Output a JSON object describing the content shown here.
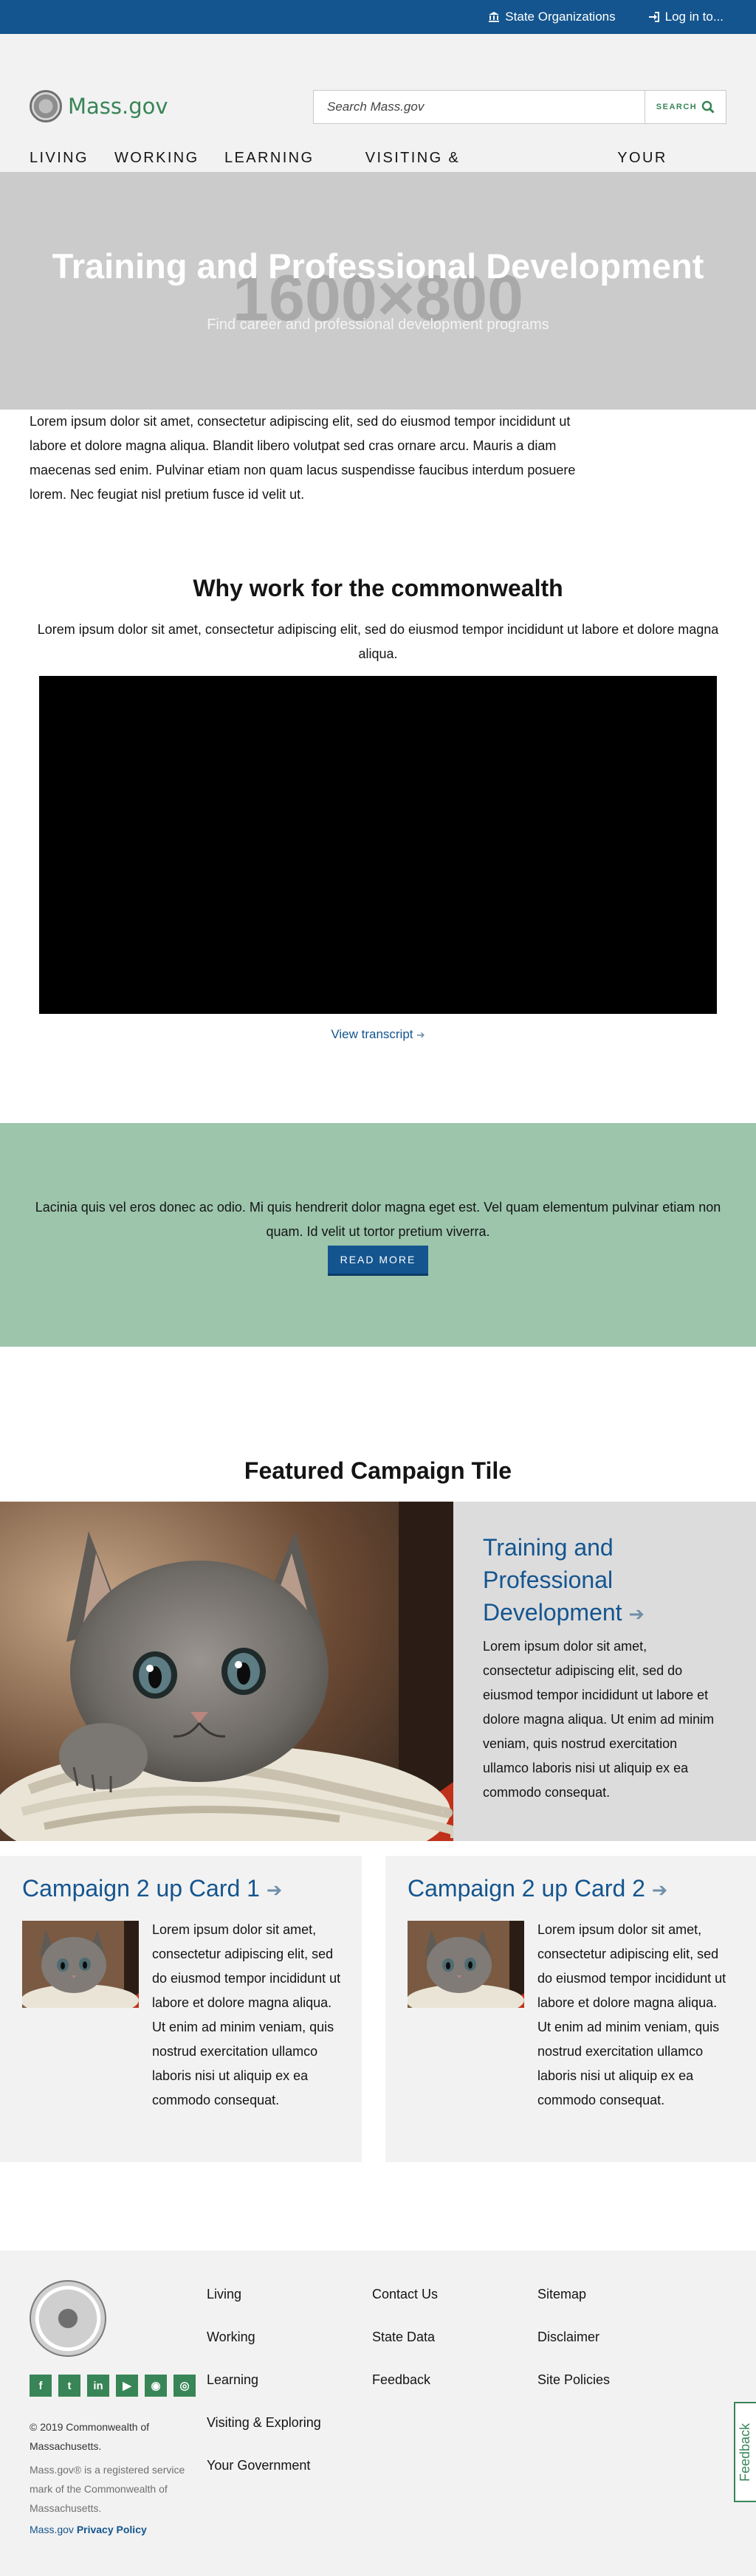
{
  "utility": {
    "state_orgs": "State Organizations",
    "login": "Log in to..."
  },
  "header": {
    "logo_text": "Mass.gov",
    "search_placeholder": "Search Mass.gov",
    "search_button": "SEARCH"
  },
  "nav": {
    "items": [
      {
        "label": "LIVING"
      },
      {
        "label": "WORKING"
      },
      {
        "label": "LEARNING"
      },
      {
        "label": "VISITING & EXPLORING"
      },
      {
        "label": "YOUR GOVERNMENT"
      }
    ]
  },
  "hero": {
    "placeholder": "1600×800",
    "title": "Training and Professional Development",
    "subtitle": "Find career and professional development programs"
  },
  "intro": {
    "text": "Lorem ipsum dolor sit amet, consectetur adipiscing elit, sed do eiusmod tempor incididunt ut labore et dolore magna aliqua. Blandit libero volutpat sed cras ornare arcu. Mauris a diam maecenas sed enim. Pulvinar etiam non quam lacus suspendisse faucibus interdum posuere lorem. Nec feugiat nisl pretium fusce id velit ut."
  },
  "why": {
    "title": "Why work for the commonwealth",
    "text": "Lorem ipsum dolor sit amet, consectetur adipiscing elit, sed do eiusmod tempor incididunt ut labore et dolore magna aliqua.",
    "transcript": "View transcript"
  },
  "band": {
    "text": "Lacinia quis vel eros donec ac odio. Mi quis hendrerit dolor magna eget est. Vel quam elementum pulvinar etiam non quam. Id velit ut tortor pretium viverra.",
    "button": "READ MORE"
  },
  "featured": {
    "heading": "Featured Campaign Tile",
    "title": "Training and Professional Development",
    "text": "Lorem ipsum dolor sit amet, consectetur adipiscing elit, sed do eiusmod tempor incididunt ut labore et dolore magna aliqua. Ut enim ad minim veniam, quis nostrud exercitation ullamco laboris nisi ut aliquip ex ea commodo consequat."
  },
  "cards": [
    {
      "title": "Campaign 2 up Card 1",
      "text": "Lorem ipsum dolor sit amet, consectetur adipiscing elit, sed do eiusmod tempor incididunt ut labore et dolore magna aliqua. Ut enim ad minim veniam, quis nostrud exercitation ullamco laboris nisi ut aliquip ex ea commodo consequat."
    },
    {
      "title": "Campaign 2 up Card 2",
      "text": "Lorem ipsum dolor sit amet, consectetur adipiscing elit, sed do eiusmod tempor incididunt ut labore et dolore magna aliqua. Ut enim ad minim veniam, quis nostrud exercitation ullamco laboris nisi ut aliquip ex ea commodo consequat."
    }
  ],
  "footer": {
    "col1": [
      "Living",
      "Working",
      "Learning",
      "Visiting & Exploring",
      "Your Government"
    ],
    "col2": [
      "Contact Us",
      "State Data",
      "Feedback"
    ],
    "col3": [
      "Sitemap",
      "Disclaimer",
      "Site Policies"
    ],
    "copyright": "© 2019 Commonwealth of Massachusetts.",
    "trademark": "Mass.gov® is a registered service mark of the Commonwealth of Massachusetts.",
    "privacy_prefix": "Mass.gov",
    "privacy": "Privacy Policy",
    "socials": [
      "facebook-icon",
      "twitter-icon",
      "linkedin-icon",
      "youtube-icon",
      "rss-icon",
      "instagram-icon"
    ]
  },
  "feedback_tab": "Feedback",
  "colors": {
    "brand_blue": "#14558f",
    "brand_green": "#388557",
    "band_green": "#9cc5ac"
  }
}
